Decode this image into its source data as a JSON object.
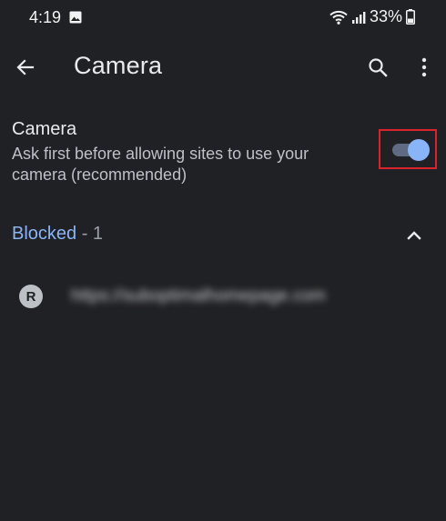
{
  "status_bar": {
    "time": "4:19",
    "battery": "33%",
    "icons": [
      "gallery-icon",
      "wifi-icon",
      "signal-icon",
      "battery-icon"
    ]
  },
  "app_bar": {
    "title": "Camera",
    "icons": [
      "back-arrow-icon",
      "search-icon",
      "more-vert-icon"
    ]
  },
  "setting": {
    "title": "Camera",
    "description": "Ask first before allowing sites to use your camera (recommended)",
    "enabled": true
  },
  "blocked": {
    "label": "Blocked",
    "count_text": " - 1",
    "expanded": true
  },
  "sites": [
    {
      "avatar_letter": "R",
      "url": "https://suboptimalhomepage.com"
    }
  ],
  "colors": {
    "background": "#202124",
    "accent": "#8ab4f8",
    "highlight": "#d9232a"
  }
}
